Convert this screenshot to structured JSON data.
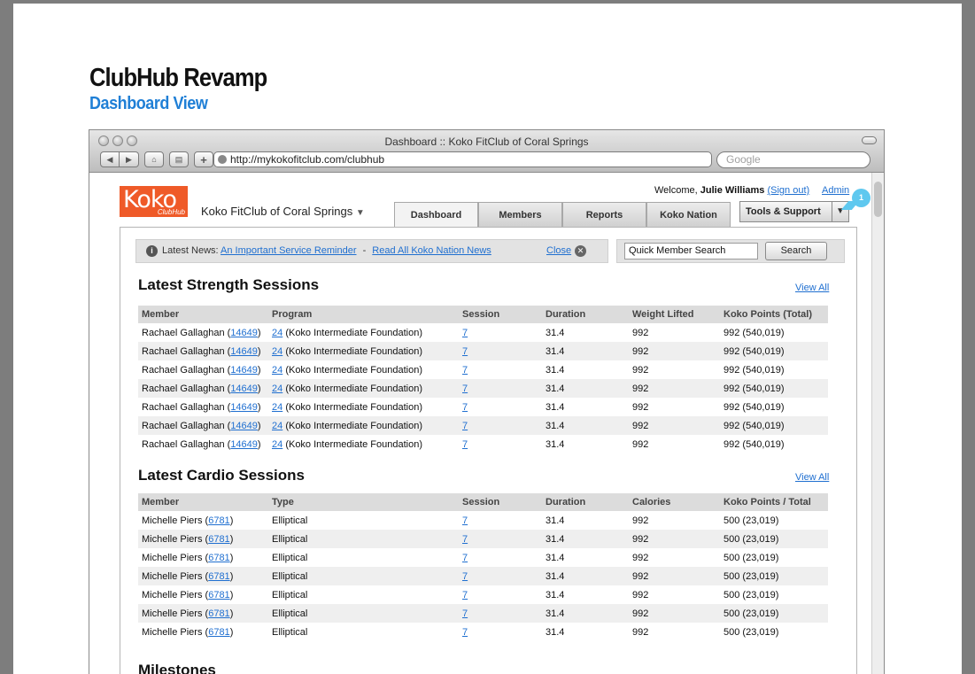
{
  "doc": {
    "title": "ClubHub Revamp",
    "subtitle": "Dashboard View"
  },
  "browser": {
    "window_title": "Dashboard :: Koko FitClub of Coral Springs",
    "url": "http://mykokofitclub.com/clubhub",
    "search_placeholder": "Google"
  },
  "header": {
    "logo_text": "Koko",
    "logo_sub": "ClubHub",
    "club_name": "Koko FitClub of Coral Springs",
    "welcome_prefix": "Welcome,",
    "user_name": "Julie Williams",
    "sign_out": "(Sign out)",
    "admin": "Admin",
    "tools_label": "Tools & Support",
    "badge": "1",
    "tabs": [
      "Dashboard",
      "Members",
      "Reports",
      "Koko Nation"
    ]
  },
  "news": {
    "label": "Latest News:",
    "link1": "An Important Service Reminder",
    "sep": "-",
    "link2": "Read All Koko Nation News",
    "close": "Close"
  },
  "quick_search": {
    "placeholder": "Quick Member Search",
    "button": "Search"
  },
  "strength": {
    "title": "Latest Strength Sessions",
    "view_all": "View All",
    "columns": [
      "Member",
      "Program",
      "Session",
      "Duration",
      "Weight Lifted",
      "Koko Points (Total)"
    ],
    "rows": [
      {
        "member": "Rachael Gallaghan",
        "member_id": "14649",
        "program_id": "24",
        "program": "(Koko Intermediate Foundation)",
        "session": "7",
        "duration": "31.4",
        "weight": "992",
        "points": "992 (540,019)"
      },
      {
        "member": "Rachael Gallaghan",
        "member_id": "14649",
        "program_id": "24",
        "program": "(Koko Intermediate Foundation)",
        "session": "7",
        "duration": "31.4",
        "weight": "992",
        "points": "992 (540,019)"
      },
      {
        "member": "Rachael Gallaghan",
        "member_id": "14649",
        "program_id": "24",
        "program": "(Koko Intermediate Foundation)",
        "session": "7",
        "duration": "31.4",
        "weight": "992",
        "points": "992 (540,019)"
      },
      {
        "member": "Rachael Gallaghan",
        "member_id": "14649",
        "program_id": "24",
        "program": "(Koko Intermediate Foundation)",
        "session": "7",
        "duration": "31.4",
        "weight": "992",
        "points": "992 (540,019)"
      },
      {
        "member": "Rachael Gallaghan",
        "member_id": "14649",
        "program_id": "24",
        "program": "(Koko Intermediate Foundation)",
        "session": "7",
        "duration": "31.4",
        "weight": "992",
        "points": "992 (540,019)"
      },
      {
        "member": "Rachael Gallaghan",
        "member_id": "14649",
        "program_id": "24",
        "program": "(Koko Intermediate Foundation)",
        "session": "7",
        "duration": "31.4",
        "weight": "992",
        "points": "992 (540,019)"
      },
      {
        "member": "Rachael Gallaghan",
        "member_id": "14649",
        "program_id": "24",
        "program": "(Koko Intermediate Foundation)",
        "session": "7",
        "duration": "31.4",
        "weight": "992",
        "points": "992 (540,019)"
      }
    ]
  },
  "cardio": {
    "title": "Latest Cardio Sessions",
    "view_all": "View All",
    "columns": [
      "Member",
      "Type",
      "Session",
      "Duration",
      "Calories",
      "Koko Points / Total"
    ],
    "rows": [
      {
        "member": "Michelle Piers",
        "member_id": "6781",
        "type": "Elliptical",
        "session": "7",
        "duration": "31.4",
        "calories": "992",
        "points": "500 (23,019)"
      },
      {
        "member": "Michelle Piers",
        "member_id": "6781",
        "type": "Elliptical",
        "session": "7",
        "duration": "31.4",
        "calories": "992",
        "points": "500 (23,019)"
      },
      {
        "member": "Michelle Piers",
        "member_id": "6781",
        "type": "Elliptical",
        "session": "7",
        "duration": "31.4",
        "calories": "992",
        "points": "500 (23,019)"
      },
      {
        "member": "Michelle Piers",
        "member_id": "6781",
        "type": "Elliptical",
        "session": "7",
        "duration": "31.4",
        "calories": "992",
        "points": "500 (23,019)"
      },
      {
        "member": "Michelle Piers",
        "member_id": "6781",
        "type": "Elliptical",
        "session": "7",
        "duration": "31.4",
        "calories": "992",
        "points": "500 (23,019)"
      },
      {
        "member": "Michelle Piers",
        "member_id": "6781",
        "type": "Elliptical",
        "session": "7",
        "duration": "31.4",
        "calories": "992",
        "points": "500 (23,019)"
      },
      {
        "member": "Michelle Piers",
        "member_id": "6781",
        "type": "Elliptical",
        "session": "7",
        "duration": "31.4",
        "calories": "992",
        "points": "500 (23,019)"
      }
    ]
  },
  "milestones": {
    "title": "Milestones"
  },
  "icons": {
    "back": "back-arrow-icon",
    "forward": "forward-arrow-icon",
    "home": "home-icon",
    "print": "print-icon",
    "add": "plus-icon",
    "globe": "globe-icon",
    "info": "info-icon",
    "close": "close-circle-icon",
    "dropdown": "chevron-down-icon"
  },
  "colors": {
    "brand": "#ef5a28",
    "link": "#1f6fd0",
    "subtitle": "#1f7fd6",
    "badge": "#5fc8ef"
  }
}
